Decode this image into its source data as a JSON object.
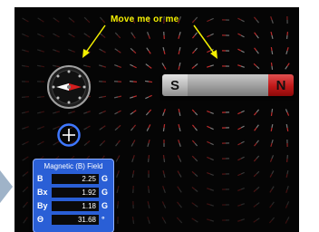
{
  "hint": {
    "text": "Move me or me"
  },
  "magnet": {
    "south_label": "S",
    "north_label": "N"
  },
  "field_panel": {
    "title": "Magnetic (B) Field",
    "rows": [
      {
        "label": "B",
        "value": "2.25",
        "unit": "G"
      },
      {
        "label": "Bx",
        "value": "1.92",
        "unit": "G"
      },
      {
        "label": "By",
        "value": "1.18",
        "unit": "G"
      },
      {
        "label": "Θ",
        "value": "31.68",
        "unit": "°"
      }
    ]
  },
  "colors": {
    "background": "#050505",
    "hint": "#f4f000",
    "panel": "#2a5fd6",
    "north": "#c01818",
    "field_needle": "#c03030"
  },
  "icons": {
    "compass": "compass-icon",
    "probe": "field-probe-crosshair-icon",
    "side": "chevron-right-icon"
  }
}
